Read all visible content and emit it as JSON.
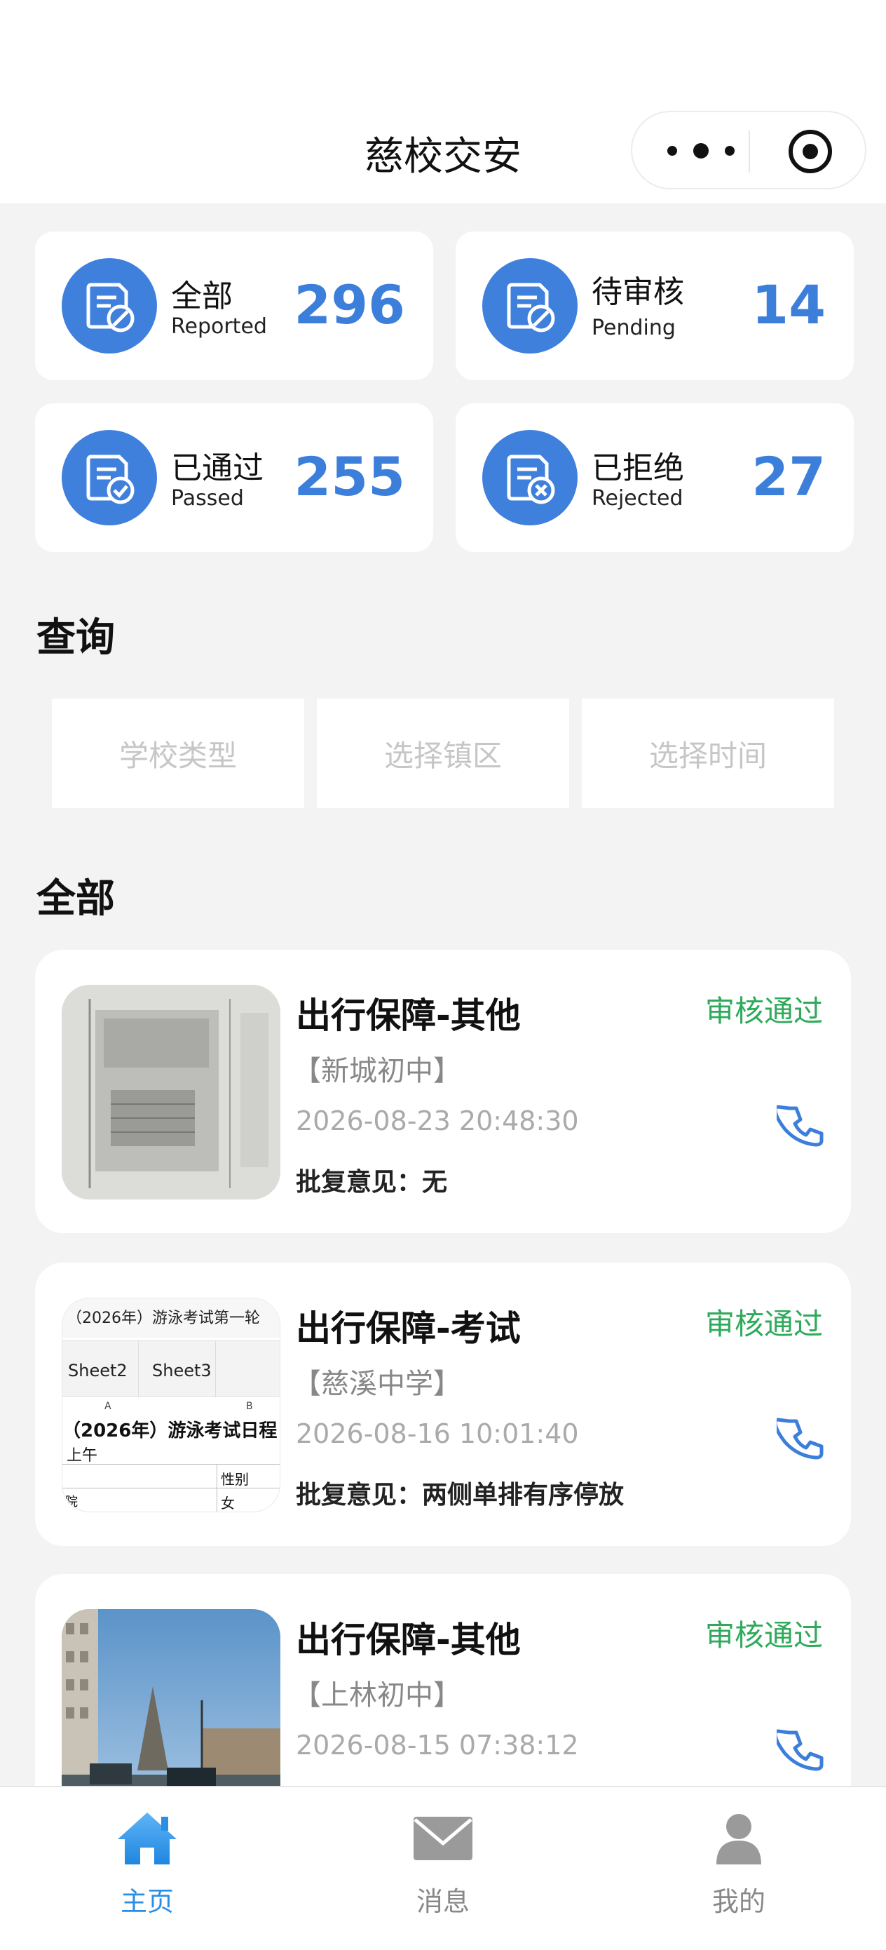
{
  "app": {
    "title": "慈校交安"
  },
  "capsule": {
    "more_icon": "more-dots-icon",
    "close_icon": "target-icon"
  },
  "stats": [
    {
      "cn": "全部",
      "en": "Reported",
      "value": "296",
      "icon": "document-slash-icon"
    },
    {
      "cn": "待审核",
      "en": "Pending",
      "value": "14",
      "icon": "document-slash-icon"
    },
    {
      "cn": "已通过",
      "en": "Passed",
      "value": "255",
      "icon": "document-check-icon"
    },
    {
      "cn": "已拒绝",
      "en": "Rejected",
      "value": "27",
      "icon": "document-x-icon"
    }
  ],
  "query": {
    "title": "查询",
    "filters": [
      {
        "placeholder": "学校类型"
      },
      {
        "placeholder": "选择镇区"
      },
      {
        "placeholder": "选择时间"
      }
    ]
  },
  "list": {
    "title": "全部",
    "items": [
      {
        "title": "出行保障-其他",
        "status": "审核通过",
        "school": "【新城初中】",
        "time": "2026-08-23 20:48:30",
        "reply": "批复意见：无"
      },
      {
        "title": "出行保障-考试",
        "status": "审核通过",
        "school": "【慈溪中学】",
        "time": "2026-08-16 10:01:40",
        "reply": "批复意见：两侧单排有序停放",
        "thumb_text": {
          "heading": "（2026年）游泳考试第一轮",
          "sheet2": "Sheet2",
          "sheet3": "Sheet3",
          "col_a": "A",
          "col_b": "B",
          "row1": "（2026年）游泳考试日程",
          "row2": "上午",
          "row3": "性别",
          "row4a": "院",
          "row4b": "女"
        }
      },
      {
        "title": "出行保障-其他",
        "status": "审核通过",
        "school": "【上林初中】",
        "time": "2026-08-15 07:38:12",
        "reply": ""
      }
    ]
  },
  "tabbar": {
    "items": [
      {
        "label": "主页",
        "icon": "home-icon",
        "active": true
      },
      {
        "label": "消息",
        "icon": "mail-icon",
        "active": false
      },
      {
        "label": "我的",
        "icon": "user-icon",
        "active": false
      }
    ]
  },
  "colors": {
    "accent": "#3c7fdb",
    "status_pass": "#2eaa5a",
    "tab_active": "#2b8ee6"
  }
}
